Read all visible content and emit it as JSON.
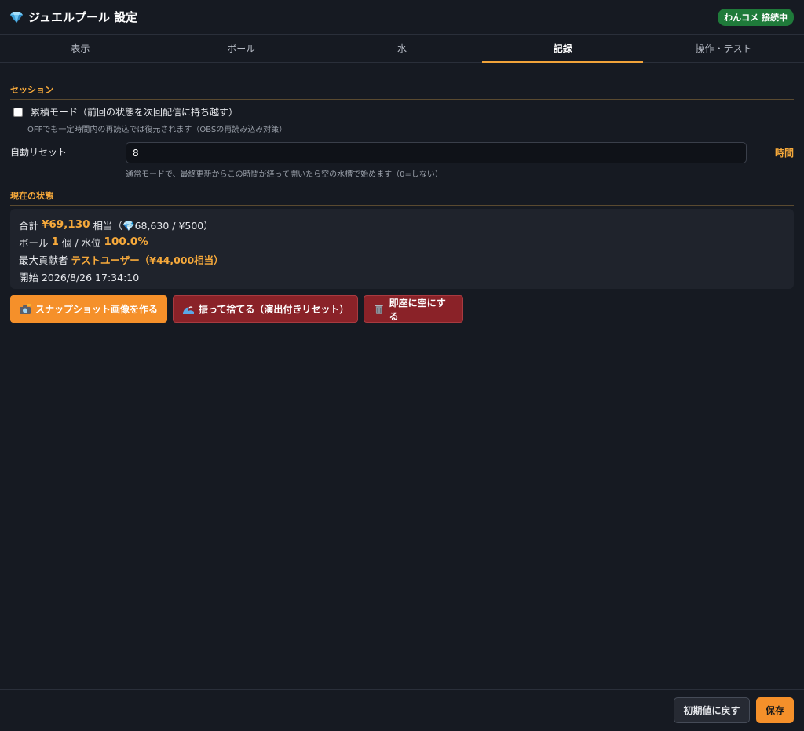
{
  "header": {
    "title": "ジュエルプール 設定",
    "status": "わんコメ 接続中"
  },
  "tabs": [
    {
      "label": "表示",
      "active": false
    },
    {
      "label": "ボール",
      "active": false
    },
    {
      "label": "水",
      "active": false
    },
    {
      "label": "記録",
      "active": true
    },
    {
      "label": "操作・テスト",
      "active": false
    }
  ],
  "session": {
    "title": "セッション",
    "cumulative_label": "累積モード（前回の状態を次回配信に持ち越す）",
    "cumulative_checked": false,
    "cumulative_hint": "OFFでも一定時間内の再読込では復元されます（OBSの再読み込み対策）",
    "auto_reset_label": "自動リセット",
    "auto_reset_value": "8",
    "auto_reset_unit": "時間",
    "auto_reset_hint": "通常モードで、最終更新からこの時間が経って開いたら空の水槽で始めます（0=しない）"
  },
  "state": {
    "title": "現在の状態",
    "total_prefix": "合計",
    "total_value": "¥69,130",
    "total_suffix": "相当（💎68,630 / ¥500）",
    "ball_prefix": "ボール",
    "ball_count": "1",
    "ball_mid": "個 / 水位",
    "water_level": "100.0%",
    "top_prefix": "最大貢献者",
    "top_value": "テストユーザー（¥44,000相当）",
    "start_label": "開始 2026/8/26 17:34:10"
  },
  "actions": {
    "snapshot": "スナップショット画像を作る",
    "shake": "振って捨てる（演出付きリセット）",
    "clear": "即座に空にする"
  },
  "footer": {
    "reset": "初期値に戻す",
    "save": "保存"
  },
  "colors": {
    "accent": "#f6a93b",
    "badge": "#1f7a3a",
    "danger": "#8a2228"
  }
}
